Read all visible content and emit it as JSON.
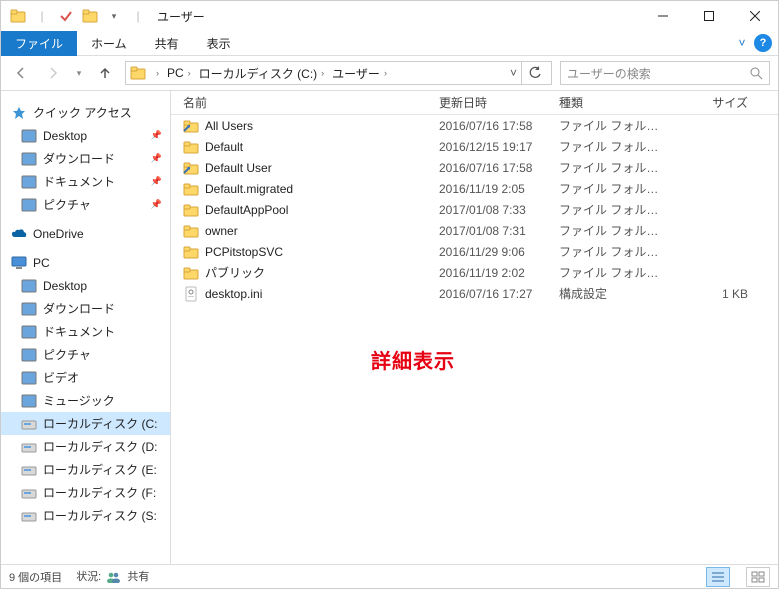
{
  "window": {
    "title": "ユーザー"
  },
  "ribbon": {
    "file": "ファイル",
    "home": "ホーム",
    "share": "共有",
    "view": "表示"
  },
  "breadcrumb": {
    "items": [
      "PC",
      "ローカルディスク (C:)",
      "ユーザー"
    ]
  },
  "search": {
    "placeholder": "ユーザーの検索"
  },
  "nav": {
    "quick": "クイック アクセス",
    "quick_items": [
      {
        "label": "Desktop",
        "pinned": true
      },
      {
        "label": "ダウンロード",
        "pinned": true
      },
      {
        "label": "ドキュメント",
        "pinned": true
      },
      {
        "label": "ピクチャ",
        "pinned": true
      }
    ],
    "onedrive": "OneDrive",
    "pc": "PC",
    "pc_items": [
      {
        "label": "Desktop"
      },
      {
        "label": "ダウンロード"
      },
      {
        "label": "ドキュメント"
      },
      {
        "label": "ピクチャ"
      },
      {
        "label": "ビデオ"
      },
      {
        "label": "ミュージック"
      },
      {
        "label": "ローカルディスク (C:"
      },
      {
        "label": "ローカルディスク (D:"
      },
      {
        "label": "ローカルディスク (E:"
      },
      {
        "label": "ローカルディスク (F:"
      },
      {
        "label": "ローカルディスク (S:"
      }
    ]
  },
  "columns": {
    "name": "名前",
    "date": "更新日時",
    "type": "種類",
    "size": "サイズ"
  },
  "rows": [
    {
      "name": "All Users",
      "date": "2016/07/16 17:58",
      "type": "ファイル フォルダー",
      "size": "",
      "icon": "folder-link"
    },
    {
      "name": "Default",
      "date": "2016/12/15 19:17",
      "type": "ファイル フォルダー",
      "size": "",
      "icon": "folder"
    },
    {
      "name": "Default User",
      "date": "2016/07/16 17:58",
      "type": "ファイル フォルダー",
      "size": "",
      "icon": "folder-link"
    },
    {
      "name": "Default.migrated",
      "date": "2016/11/19 2:05",
      "type": "ファイル フォルダー",
      "size": "",
      "icon": "folder"
    },
    {
      "name": "DefaultAppPool",
      "date": "2017/01/08 7:33",
      "type": "ファイル フォルダー",
      "size": "",
      "icon": "folder"
    },
    {
      "name": "owner",
      "date": "2017/01/08 7:31",
      "type": "ファイル フォルダー",
      "size": "",
      "icon": "folder"
    },
    {
      "name": "PCPitstopSVC",
      "date": "2016/11/29 9:06",
      "type": "ファイル フォルダー",
      "size": "",
      "icon": "folder"
    },
    {
      "name": "パブリック",
      "date": "2016/11/19 2:02",
      "type": "ファイル フォルダー",
      "size": "",
      "icon": "folder"
    },
    {
      "name": "desktop.ini",
      "date": "2016/07/16 17:27",
      "type": "構成設定",
      "size": "1 KB",
      "icon": "file-ini"
    }
  ],
  "status": {
    "count": "9 個の項目",
    "state_label": "状況:",
    "state": "共有"
  },
  "annotation": "詳細表示"
}
